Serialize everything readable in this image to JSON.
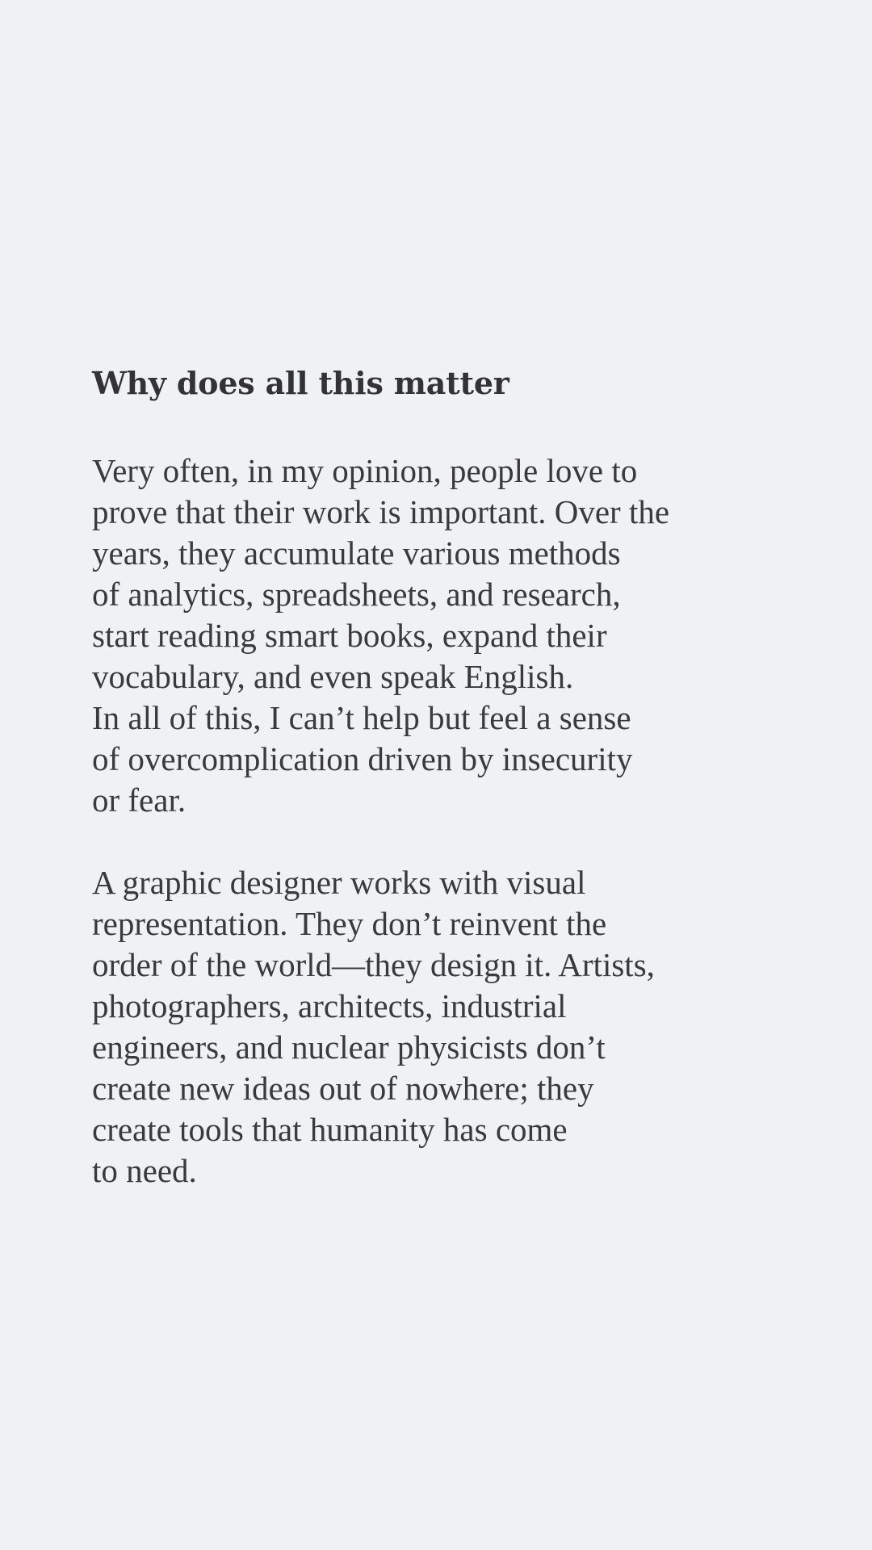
{
  "article": {
    "heading": "Why does all this matter",
    "paragraphs": [
      {
        "lines": [
          "Very often, in my opinion, people love to",
          "prove that their work is important. Over the",
          "years, they accumulate various methods",
          "of analytics, spreadsheets, and research,",
          "start reading smart books, expand their",
          "vocabulary, and even speak English.",
          "In all of this, I can’t help but feel a sense",
          "of overcomplication driven by insecurity",
          "or fear."
        ]
      },
      {
        "lines": [
          "A graphic designer works with visual",
          "representation. They don’t reinvent the",
          "order of the world—they design it. Artists,",
          "photographers, architects, industrial",
          "engineers, and nuclear physicists don’t",
          "create new ideas out of nowhere; they",
          "create tools that humanity has come",
          "to need."
        ]
      }
    ]
  }
}
